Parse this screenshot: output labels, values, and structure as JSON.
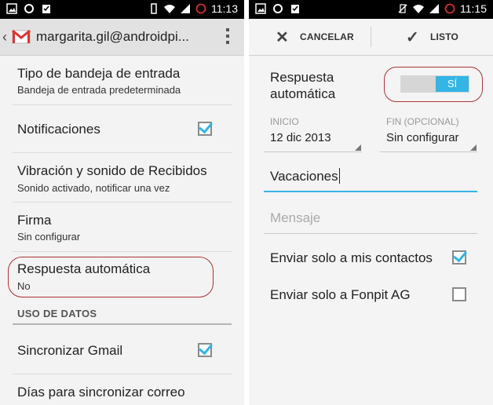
{
  "left": {
    "status_time": "11:13",
    "account": "margarita.gil@androidpi...",
    "settings": [
      {
        "title": "Tipo de bandeja de entrada",
        "subtitle": "Bandeja de entrada predeterminada"
      },
      {
        "title": "Notificaciones",
        "checked": true
      },
      {
        "title": "Vibración y sonido de Recibidos",
        "subtitle": "Sonido activado, notificar una vez"
      },
      {
        "title": "Firma",
        "subtitle": "Sin configurar"
      },
      {
        "title": "Respuesta automática",
        "subtitle": "No"
      }
    ],
    "section_header": "USO DE DATOS",
    "data_settings": [
      {
        "title": "Sincronizar Gmail",
        "checked": true
      },
      {
        "title": "Días para sincronizar correo"
      }
    ]
  },
  "right": {
    "status_time": "11:15",
    "cancel_label": "CANCELAR",
    "done_label": "LISTO",
    "auto_reply_label": "Respuesta\nautomática",
    "auto_reply_line1": "Respuesta",
    "auto_reply_line2": "automática",
    "toggle_label": "SÍ",
    "start_label": "INICIO",
    "start_value": "12 dic 2013",
    "end_label": "FIN (OPCIONAL)",
    "end_value": "Sin configurar",
    "subject_value": "Vacaciones",
    "message_placeholder": "Mensaje",
    "contacts_only_label": "Enviar solo a mis contactos",
    "contacts_only_checked": true,
    "domain_only_label": "Enviar solo a Fonpit AG",
    "domain_only_checked": false
  },
  "colors": {
    "accent": "#33b5e5",
    "highlight": "#a33333"
  }
}
